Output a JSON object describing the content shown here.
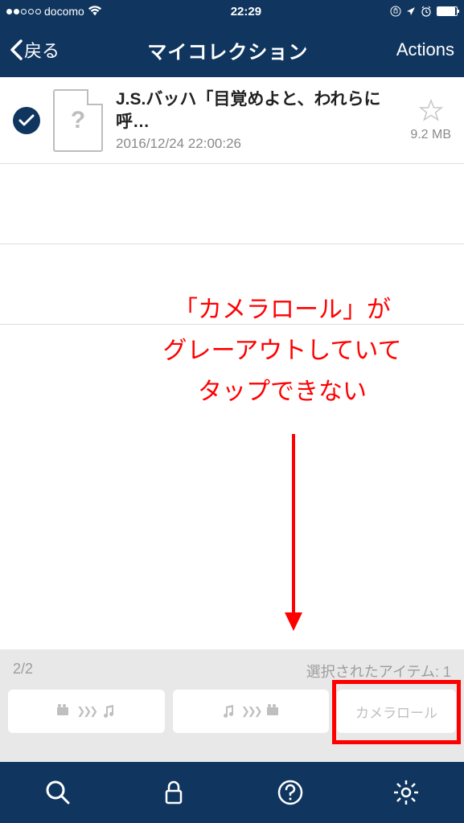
{
  "status_bar": {
    "carrier": "docomo",
    "time": "22:29"
  },
  "nav": {
    "back_label": "戻る",
    "title": "マイコレクション",
    "actions_label": "Actions"
  },
  "list": {
    "items": [
      {
        "title": "J.S.バッハ「目覚めよと、われらに呼…",
        "date": "2016/12/24 22:00:26",
        "size": "9.2 MB"
      }
    ]
  },
  "annotation": {
    "line1": "「カメラロール」が",
    "line2": "グレーアウトしていて",
    "line3": "タップできない"
  },
  "toolbar": {
    "count": "2/2",
    "selected": "選択されたアイテム: 1",
    "camera_roll": "カメラロール"
  }
}
